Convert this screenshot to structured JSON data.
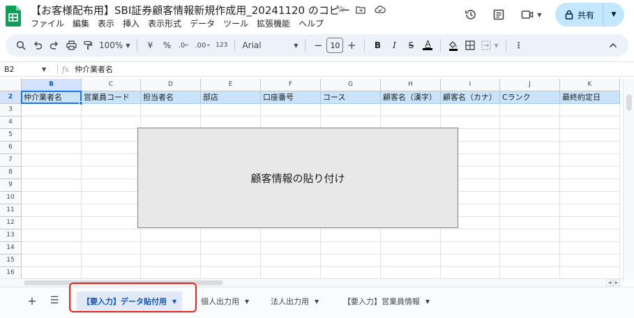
{
  "app": {
    "title": "【お客様配布用】SBI証券顧客情報新規作成用_20241120 のコピー",
    "menu": [
      "ファイル",
      "編集",
      "表示",
      "挿入",
      "表示形式",
      "データ",
      "ツール",
      "拡張機能",
      "ヘルプ"
    ],
    "share_label": "共有"
  },
  "toolbar": {
    "zoom": "100%",
    "currency": "¥",
    "percent": "%",
    "decimal_decrease": ".0",
    "decimal_increase": ".00",
    "number_format": "123",
    "font": "Arial",
    "font_size": "10",
    "minus": "−",
    "plus": "+",
    "bold": "B",
    "italic": "I",
    "strike": "S",
    "text_color": "A"
  },
  "formula_bar": {
    "cell_ref": "B2",
    "fx": "fx",
    "value": "仲介業者名"
  },
  "grid": {
    "columns": [
      "B",
      "C",
      "D",
      "E",
      "F",
      "G",
      "H",
      "I",
      "J",
      "K"
    ],
    "header_row_number": "2",
    "header_cells": [
      "仲介業者名",
      "営業員コード",
      "担当者名",
      "部店",
      "口座番号",
      "コース",
      "顧客名（漢字）",
      "顧客名（カナ）",
      "Cランク",
      "最終約定日"
    ],
    "row_numbers": [
      "3",
      "4",
      "5",
      "6",
      "7",
      "8",
      "9",
      "10",
      "11",
      "12",
      "13",
      "14",
      "15",
      "16"
    ],
    "overlay_text": "顧客情報の貼り付け"
  },
  "sheets": [
    {
      "label": "【要入力】データ貼付用",
      "active": true
    },
    {
      "label": "個人出力用",
      "active": false
    },
    {
      "label": "法人出力用",
      "active": false
    },
    {
      "label": "【要入力】営業員情報",
      "active": false
    }
  ],
  "colors": {
    "accent": "#1a73e8",
    "header_fill": "#c9e3f8",
    "highlight_frame": "#e8251c",
    "share_button": "#c2e7ff"
  }
}
